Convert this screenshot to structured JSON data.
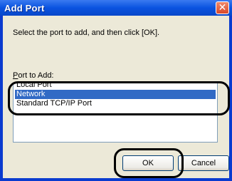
{
  "window": {
    "title": "Add Port",
    "close_glyph": "✕"
  },
  "instruction": "Select the port to add, and then click [OK].",
  "port_list": {
    "label": "Port to Add:",
    "items": [
      {
        "label": "Local Port",
        "selected": false
      },
      {
        "label": "Network",
        "selected": true
      },
      {
        "label": "Standard TCP/IP Port",
        "selected": false
      }
    ]
  },
  "buttons": {
    "ok": "OK",
    "cancel": "Cancel"
  },
  "colors": {
    "selection": "#316ac5",
    "titlebar": "#0a53e0"
  }
}
